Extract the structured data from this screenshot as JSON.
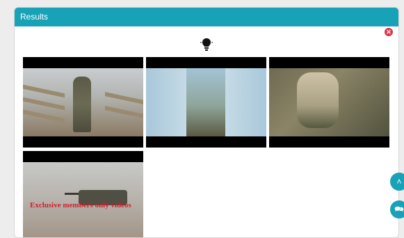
{
  "panel": {
    "title": "Results",
    "close_symbol": "✕"
  },
  "bulb_icon": "lightbulb-icon",
  "thumbnails": [
    {
      "name": "video-thumbnail-1",
      "overlay_text": ""
    },
    {
      "name": "video-thumbnail-2",
      "overlay_text": ""
    },
    {
      "name": "video-thumbnail-3",
      "overlay_text": ""
    },
    {
      "name": "video-thumbnail-4",
      "overlay_text": "Exclusive members only videos"
    }
  ],
  "fabs": {
    "up_symbol": "˄",
    "chat_symbol": "🗪"
  },
  "colors": {
    "accent": "#17a2b8",
    "close": "#e0344a",
    "overlay_text": "#d2202a"
  }
}
